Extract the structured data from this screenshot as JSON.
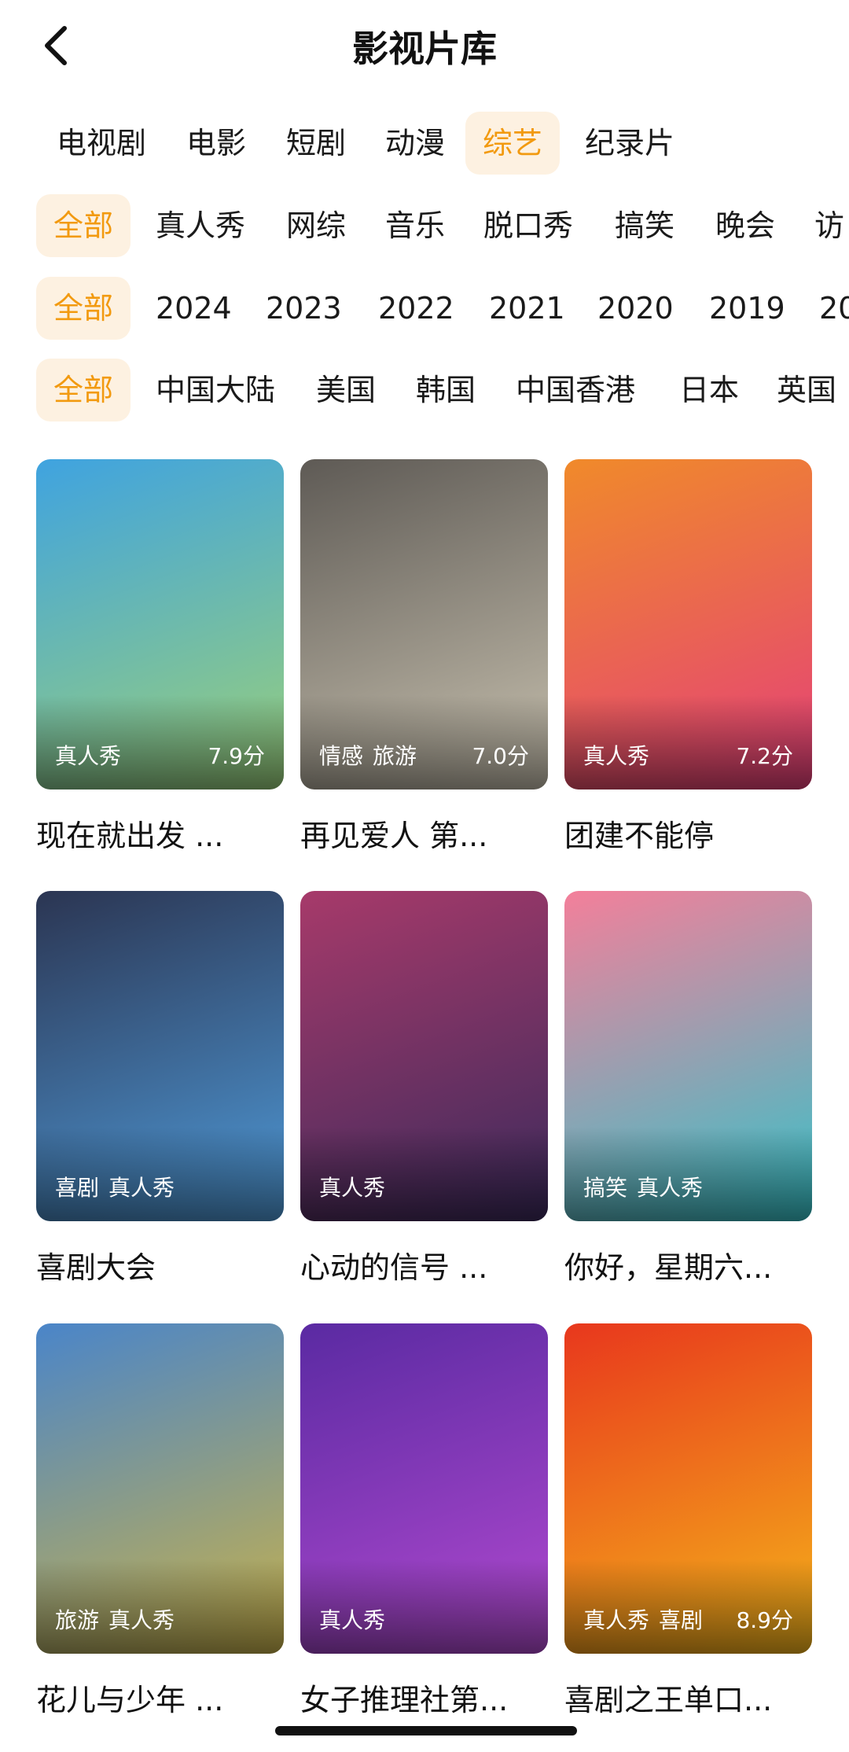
{
  "header": {
    "title": "影视片库"
  },
  "categories": [
    "电视剧",
    "电影",
    "短剧",
    "动漫",
    "综艺",
    "纪录片"
  ],
  "genres": [
    "全部",
    "真人秀",
    "网综",
    "音乐",
    "脱口秀",
    "搞笑",
    "晚会",
    "访"
  ],
  "years": [
    "全部",
    "2024",
    "2023",
    "2022",
    "2021",
    "2020",
    "2019",
    "20"
  ],
  "regions": [
    "全部",
    "中国大陆",
    "美国",
    "韩国",
    "中国香港",
    "日本",
    "英国"
  ],
  "cards": [
    {
      "title": "现在就出发 ...",
      "tags": [
        "真人秀"
      ],
      "score": "7.9分",
      "colors": [
        "#3fa3e0",
        "#9ad07a"
      ]
    },
    {
      "title": "再见爱人 第...",
      "tags": [
        "情感",
        "旅游"
      ],
      "score": "7.0分",
      "colors": [
        "#5e5a55",
        "#c9c2b0"
      ]
    },
    {
      "title": "团建不能停",
      "tags": [
        "真人秀"
      ],
      "score": "7.2分",
      "colors": [
        "#f08a2a",
        "#e43f7a"
      ]
    },
    {
      "title": "喜剧大会",
      "tags": [
        "喜剧",
        "真人秀"
      ],
      "score": "",
      "colors": [
        "#2b3552",
        "#4f9ad8"
      ]
    },
    {
      "title": "心动的信号 ...",
      "tags": [
        "真人秀"
      ],
      "score": "",
      "colors": [
        "#a73a6a",
        "#3b2a5c"
      ]
    },
    {
      "title": "你好，星期六...",
      "tags": [
        "搞笑",
        "真人秀"
      ],
      "score": "",
      "colors": [
        "#f47f9a",
        "#34c3c9"
      ]
    },
    {
      "title": "花儿与少年 ...",
      "tags": [
        "旅游",
        "真人秀"
      ],
      "score": "",
      "colors": [
        "#4a85c9",
        "#c9b24a"
      ]
    },
    {
      "title": "女子推理社第...",
      "tags": [
        "真人秀"
      ],
      "score": "",
      "colors": [
        "#5a2aa2",
        "#b24ad0"
      ]
    },
    {
      "title": "喜剧之王单口...",
      "tags": [
        "真人秀",
        "喜剧"
      ],
      "score": "8.9分",
      "colors": [
        "#e8371d",
        "#f5b51a"
      ]
    }
  ]
}
